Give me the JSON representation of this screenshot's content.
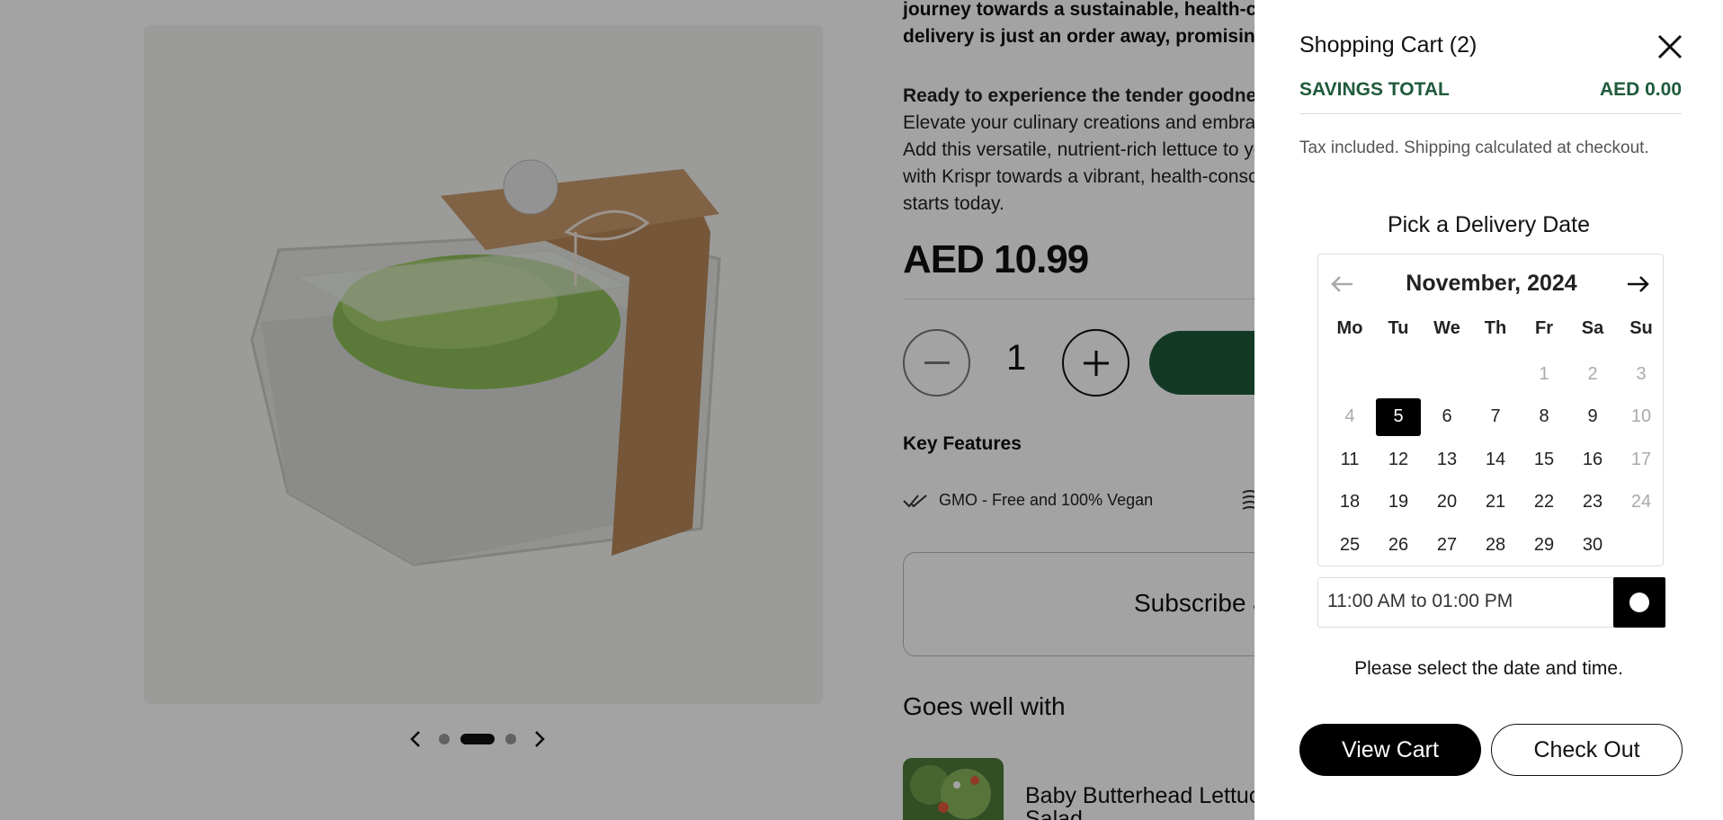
{
  "product": {
    "description_lines_bold": [
      "journey towards a sustainable, health-cons",
      "delivery is just an order away, promising pe"
    ],
    "cta_heading": "Ready to experience the tender goodness",
    "cta_lines": [
      "Elevate your culinary creations and embrac",
      "Add this versatile, nutrient-rich lettuce to yo",
      "with Krispr towards a vibrant, health-consc",
      "starts today."
    ],
    "price": "AED 10.99",
    "quantity": "1",
    "key_features_title": "Key Features",
    "feature_1": "GMO - Free and 100% Vegan",
    "subscribe_label": "Subscribe &",
    "goes_well_title": "Goes well with",
    "related_item_name": "Baby Butterhead Lettuce Salad",
    "gallery": {
      "slides": 3,
      "active_index": 1
    },
    "accent_color": "#1f5a3a"
  },
  "cart": {
    "title": "Shopping Cart (2)",
    "savings_label": "SAVINGS TOTAL",
    "savings_value": "AED 0.00",
    "tax_note": "Tax included. Shipping calculated at checkout.",
    "delivery_title": "Pick a Delivery Date",
    "calendar": {
      "month_label": "November, 2024",
      "weekdays": [
        "Mo",
        "Tu",
        "We",
        "Th",
        "Fr",
        "Sa",
        "Su"
      ],
      "leading_blanks": 4,
      "days_in_month": 30,
      "selected_day": 5,
      "disabled_days": [
        1,
        2,
        3,
        4,
        10,
        17,
        24
      ]
    },
    "time_slot": "11:00 AM to 01:00 PM",
    "select_note": "Please select the date and time.",
    "view_cart_label": "View Cart",
    "checkout_label": "Check Out"
  }
}
